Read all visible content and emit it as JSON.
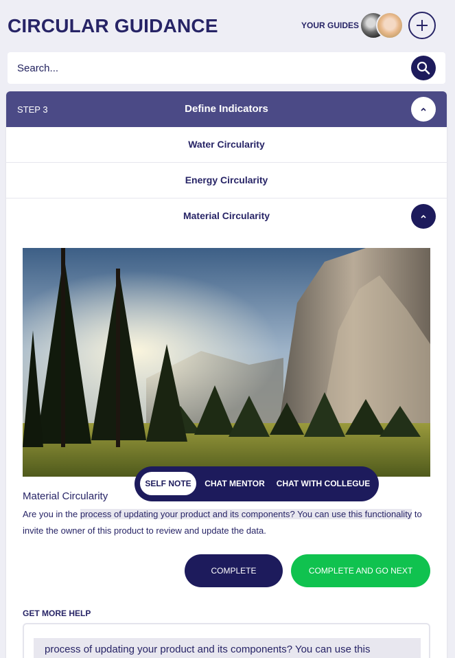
{
  "header": {
    "title": "CIRCULAR GUIDANCE",
    "guides_label": "YOUR GUIDES"
  },
  "search": {
    "placeholder": "Search..."
  },
  "step": {
    "label": "STEP 3",
    "title": "Define Indicators"
  },
  "indicators": [
    {
      "label": "Water Circularity"
    },
    {
      "label": "Energy Circularity"
    },
    {
      "label": "Material Circularity"
    }
  ],
  "detail": {
    "title": "Material Circularity",
    "desc_start": "Are you in the ",
    "desc_highlight": "process of updating your product and its components? You can use this functionality",
    "desc_end": " to invite the owner of this product to review and update the data."
  },
  "chat_tabs": [
    {
      "label": "SELF NOTE",
      "active": true
    },
    {
      "label": "CHAT MENTOR",
      "active": false
    },
    {
      "label": "CHAT WITH COLLEGUE",
      "active": false
    }
  ],
  "actions": {
    "complete": "COMPLETE",
    "complete_next": "COMPLETE AND GO NEXT"
  },
  "help": {
    "label": "GET MORE HELP",
    "text": "process of updating your product and its components? You can use this"
  },
  "icons": [
    "plus-icon",
    "search-icon",
    "chevron-up-icon"
  ],
  "colors": {
    "brand_navy": "#1d1b5c",
    "step_header": "#4b4a86",
    "accent_green": "#10c24f",
    "background": "#eeeef5"
  }
}
